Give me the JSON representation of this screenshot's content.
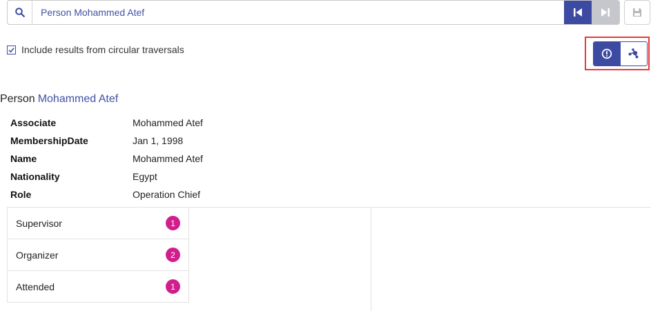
{
  "search": {
    "query": "Person Mohammed Atef"
  },
  "icons": {
    "search": "search-icon",
    "first": "skip-to-first-icon",
    "last": "skip-to-last-icon",
    "save": "save-icon",
    "alert": "alert-circle-icon",
    "graph": "graph-nodes-icon",
    "checkbox": "checkmark-icon"
  },
  "options": {
    "circular_label": "Include results from circular traversals",
    "circular_checked": true
  },
  "entity": {
    "type": "Person",
    "name": "Mohammed Atef"
  },
  "properties": [
    {
      "key": "Associate",
      "value": "Mohammed Atef"
    },
    {
      "key": "MembershipDate",
      "value": "Jan 1, 1998"
    },
    {
      "key": "Name",
      "value": "Mohammed Atef"
    },
    {
      "key": "Nationality",
      "value": "Egypt"
    },
    {
      "key": "Role",
      "value": "Operation Chief"
    }
  ],
  "relations": [
    {
      "label": "Supervisor",
      "count": "1"
    },
    {
      "label": "Organizer",
      "count": "2"
    },
    {
      "label": "Attended",
      "count": "1"
    }
  ],
  "colors": {
    "accent": "#3c4aa1",
    "badge": "#d11e8d",
    "highlight": "#e53935",
    "disabled": "#c6c7cc"
  }
}
